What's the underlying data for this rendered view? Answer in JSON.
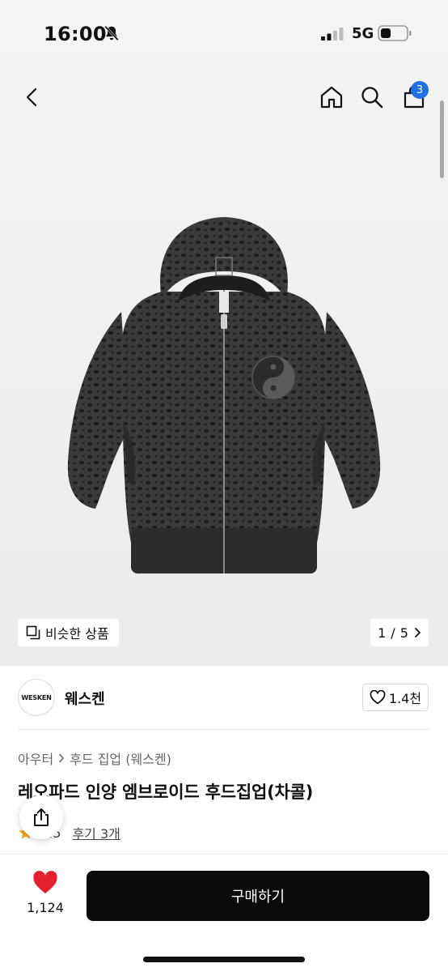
{
  "status_bar": {
    "time": "16:00",
    "network": "5G",
    "icons": [
      "bell-slash-icon",
      "signal-icon",
      "battery-icon"
    ]
  },
  "nav": {
    "icons": [
      "back-icon",
      "home-icon",
      "search-icon",
      "cart-icon"
    ],
    "cart_count": "3"
  },
  "gallery": {
    "similar_label": "비슷한 상품",
    "page_current": "1",
    "page_separator": "/",
    "page_total": "5"
  },
  "shop": {
    "logo_text": "WESKEN",
    "name": "웨스켄",
    "like_count": "1.4천"
  },
  "product": {
    "breadcrumb": [
      "아우터",
      "후드 집업 (웨스켄)"
    ],
    "title": "레오파드 인양 엠브로이드 후드집업(차콜)",
    "rating": "4.5",
    "review_link": "후기 3개"
  },
  "bottom_bar": {
    "wish_count": "1,124",
    "buy_label": "구매하기"
  },
  "colors": {
    "accent": "#1f6fe6",
    "heart": "#e5202e",
    "star": "#f5a623",
    "buy_button": "#0b0b0b"
  }
}
